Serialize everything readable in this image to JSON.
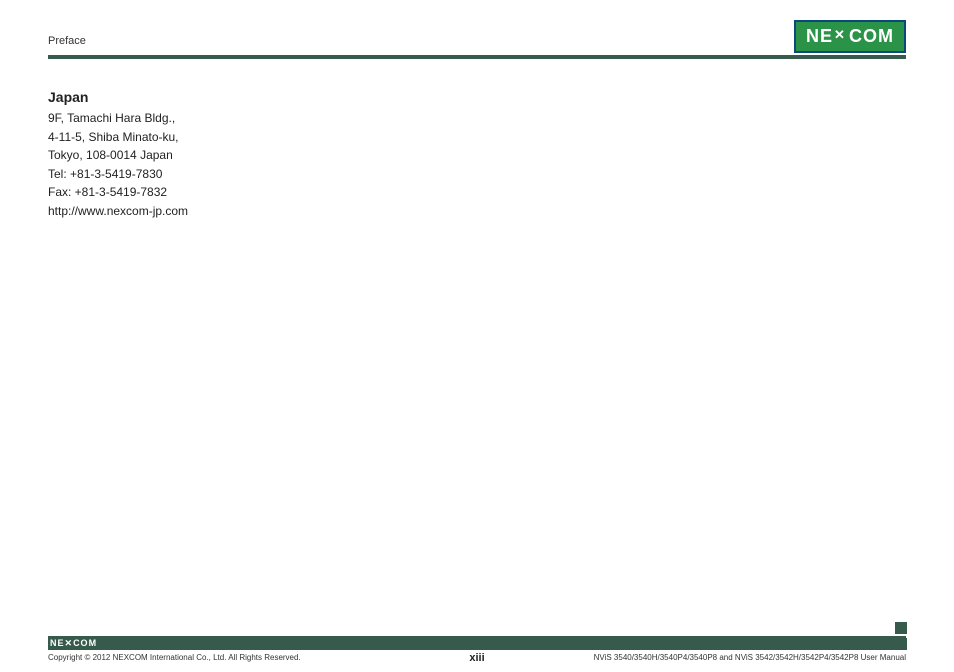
{
  "header": {
    "label": "Preface",
    "logo_left": "NE",
    "logo_right": "COM"
  },
  "content": {
    "section_title": "Japan",
    "lines": [
      "9F, Tamachi Hara Bldg.,",
      "4-11-5, Shiba Minato-ku,",
      "Tokyo, 108-0014 Japan",
      "Tel: +81-3-5419-7830",
      "Fax: +81-3-5419-7832",
      "http://www.nexcom-jp.com"
    ]
  },
  "footer": {
    "logo_left": "NE",
    "logo_right": "COM",
    "copyright": "Copyright © 2012 NEXCOM International Co., Ltd. All Rights Reserved.",
    "page_number": "xiii",
    "manual_ref": "NViS 3540/3540H/3540P4/3540P8 and NViS 3542/3542H/3542P4/3542P8 User Manual"
  }
}
